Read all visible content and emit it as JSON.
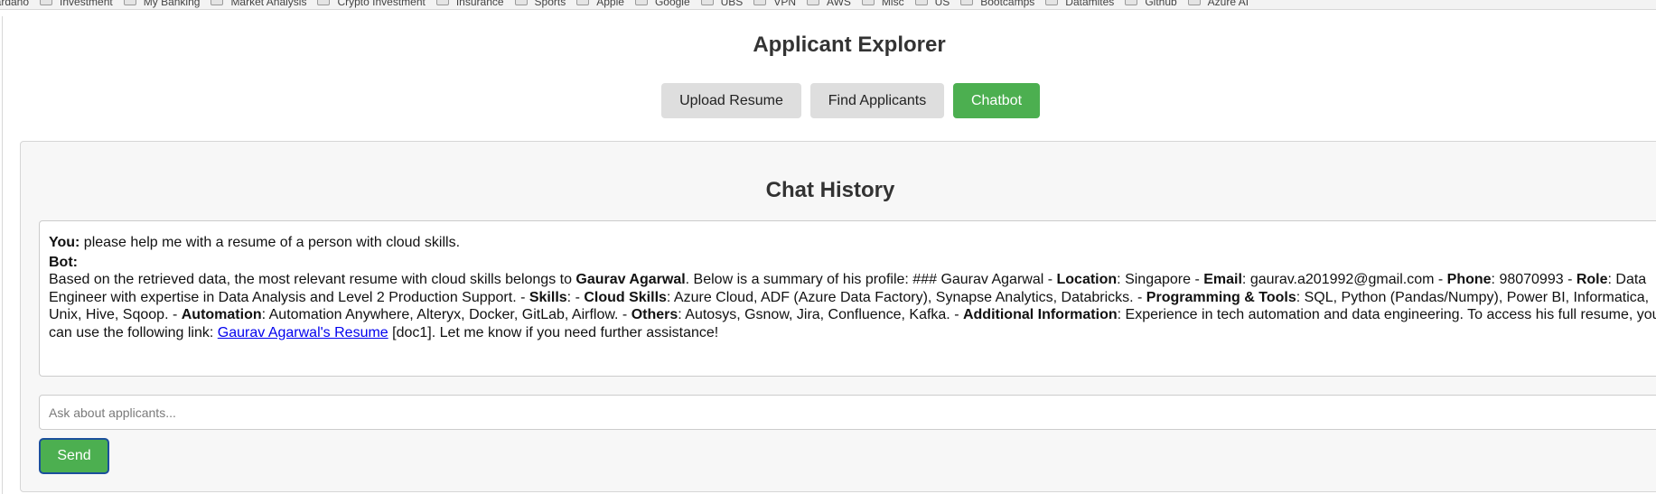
{
  "bookmarks": [
    "Cardano",
    "Investment",
    "My Banking",
    "Market Analysis",
    "Crypto Investment",
    "Insurance",
    "Sports",
    "Apple",
    "Google",
    "UBS",
    "VPN",
    "AWS",
    "Misc",
    "US",
    "Bootcamps",
    "Datamites",
    "Github",
    "Azure AI"
  ],
  "app": {
    "title": "Applicant Explorer"
  },
  "tabs": {
    "upload": "Upload Resume",
    "find": "Find Applicants",
    "chatbot": "Chatbot"
  },
  "chat": {
    "heading": "Chat History",
    "user_label": "You:",
    "user_text": " please help me with a resume of a person with cloud skills.",
    "bot_label": "Bot:",
    "bot": {
      "t1": "Based on the retrieved data, the most relevant resume with cloud skills belongs to ",
      "name": "Gaurav Agarwal",
      "t2": ". Below is a summary of his profile: ### Gaurav Agarwal - ",
      "location_label": "Location",
      "location": ": Singapore - ",
      "email_label": "Email",
      "email": ": gaurav.a201992@gmail.com - ",
      "phone_label": "Phone",
      "phone": ": 98070993 - ",
      "role_label": "Role",
      "role": ": Data Engineer with expertise in Data Analysis and Level 2 Production Support. - ",
      "skills_label": "Skills",
      "skills": ": - ",
      "cloud_label": "Cloud Skills",
      "cloud": ": Azure Cloud, ADF (Azure Data Factory), Synapse Analytics, Databricks. - ",
      "prog_label": "Programming & Tools",
      "prog": ": SQL, Python (Pandas/Numpy), Power BI, Informatica, Unix, Hive, Sqoop. - ",
      "auto_label": "Automation",
      "auto": ": Automation Anywhere, Alteryx, Docker, GitLab, Airflow. - ",
      "others_label": "Others",
      "others": ": Autosys, Gsnow, Jira, Confluence, Kafka. - ",
      "addl_label": "Additional Information",
      "addl": ": Experience in tech automation and data engineering. To access his full resume, you can use the following link: ",
      "link": "Gaurav Agarwal's Resume",
      "t3": " [doc1]. Let me know if you need further assistance!"
    },
    "input_placeholder": "Ask about applicants...",
    "send": "Send"
  },
  "colors": {
    "accent": "#4caf50",
    "link": "#0000ee"
  }
}
